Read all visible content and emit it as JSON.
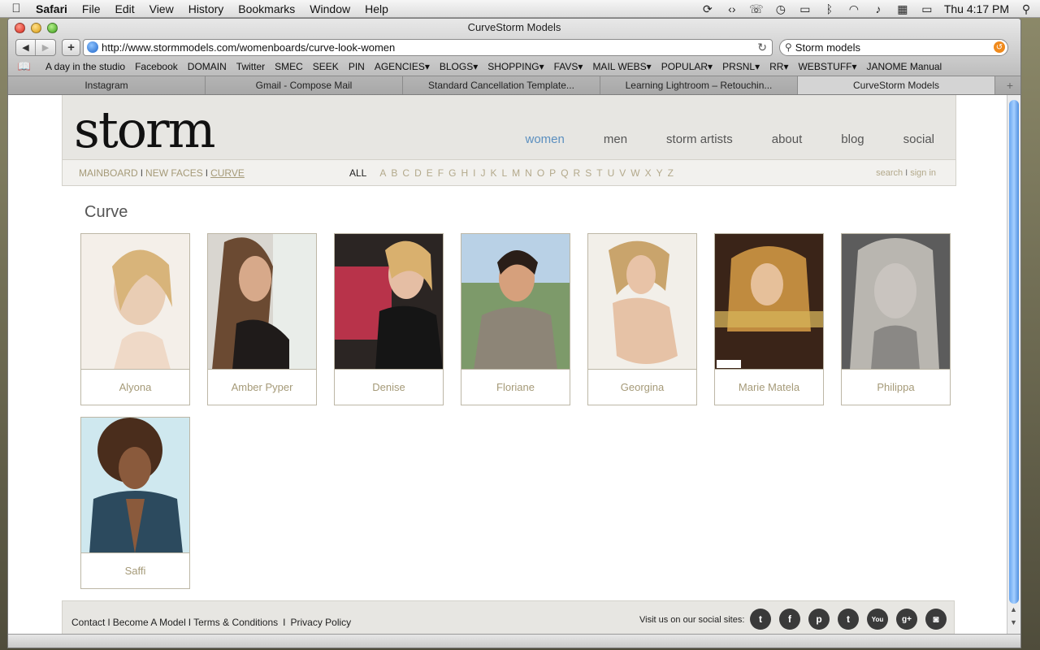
{
  "menubar": {
    "app": "Safari",
    "items": [
      "File",
      "Edit",
      "View",
      "History",
      "Bookmarks",
      "Window",
      "Help"
    ],
    "clock": "Thu 4:17 PM"
  },
  "window": {
    "title": "CurveStorm Models"
  },
  "toolbar": {
    "url": "http://www.stormmodels.com/womenboards/curve-look-women",
    "search_value": "Storm models"
  },
  "bookmarks": [
    "A day in the studio",
    "Facebook",
    "DOMAIN",
    "Twitter",
    "SMEC",
    "SEEK",
    "PIN",
    "AGENCIES▾",
    "BLOGS▾",
    "SHOPPING▾",
    "FAVS▾",
    "MAIL WEBS▾",
    "POPULAR▾",
    "PRSNL▾",
    "RR▾",
    "WEBSTUFF▾",
    "JANOME Manual"
  ],
  "tabs": [
    "Instagram",
    "Gmail - Compose Mail",
    "Standard Cancellation Template...",
    "Learning Lightroom – Retouchin...",
    "CurveStorm Models"
  ],
  "site": {
    "logo": "storm",
    "nav": [
      "women",
      "men",
      "storm artists",
      "about",
      "blog",
      "social"
    ],
    "subnav": {
      "mainboard": "MAINBOARD",
      "new_faces": "NEW FACES",
      "curve": "CURVE",
      "sep": "I"
    },
    "alpha_all": "ALL",
    "alpha": [
      "A",
      "B",
      "C",
      "D",
      "E",
      "F",
      "G",
      "H",
      "I",
      "J",
      "K",
      "L",
      "M",
      "N",
      "O",
      "P",
      "Q",
      "R",
      "S",
      "T",
      "U",
      "V",
      "W",
      "X",
      "Y",
      "Z"
    ],
    "search": "search",
    "signin": "sign in",
    "section_title": "Curve",
    "models": [
      {
        "name": "Alyona"
      },
      {
        "name": "Amber Pyper"
      },
      {
        "name": "Denise"
      },
      {
        "name": "Floriane"
      },
      {
        "name": "Georgina"
      },
      {
        "name": "Marie Matela"
      },
      {
        "name": "Philippa"
      },
      {
        "name": "Saffi"
      }
    ],
    "footer": {
      "links": [
        "Contact",
        "Become A Model",
        "Terms & Conditions",
        "Privacy Policy"
      ],
      "social_label": "Visit us on our social sites:"
    }
  },
  "colors": {
    "accent": "#5b8fbf",
    "gold": "#a59a78",
    "header_bg": "#e7e6e2"
  }
}
